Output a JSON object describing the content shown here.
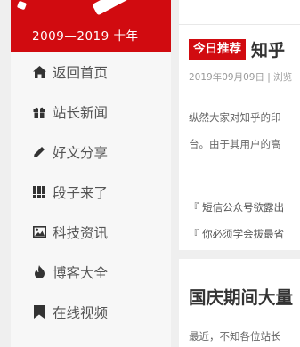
{
  "banner": {
    "text": "2009—2019 十年"
  },
  "sidebar": {
    "items": [
      {
        "label": "返回首页",
        "icon": "home-icon"
      },
      {
        "label": "站长新闻",
        "icon": "gift-icon"
      },
      {
        "label": "好文分享",
        "icon": "pencil-icon"
      },
      {
        "label": "段子来了",
        "icon": "grid-icon"
      },
      {
        "label": "科技资讯",
        "icon": "image-icon"
      },
      {
        "label": "博客大全",
        "icon": "fire-icon"
      },
      {
        "label": "在线视频",
        "icon": "bookmark-icon"
      }
    ]
  },
  "article": {
    "badge": "今日推荐",
    "title": "知乎",
    "meta": "2019年09月09日 | 浏览",
    "excerpt_line1": "纵然大家对知乎的印",
    "excerpt_line2": "台。由于其用户的高",
    "related": [
      "『 短信公众号欲露出",
      "『 你必须学会拔最省"
    ]
  },
  "article2": {
    "title": "国庆期间大量",
    "excerpt": "最近，不知各位站长"
  },
  "colors": {
    "brand_red": "#d10b10",
    "sidebar_bg": "#f7f7f7",
    "icon": "#333333"
  }
}
